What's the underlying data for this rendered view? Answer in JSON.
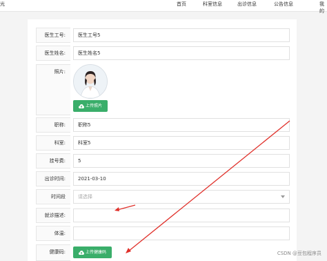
{
  "header": {
    "brand": "光",
    "nav": [
      "首页",
      "科室信息",
      "出诊信息",
      "公告信息",
      "我的"
    ]
  },
  "form": {
    "doctor_id": {
      "label": "医生工号:",
      "value": "医生工号5"
    },
    "doctor_name": {
      "label": "医生姓名:",
      "value": "医生姓名5"
    },
    "photo": {
      "label": "照片:",
      "upload_label": "上传照片"
    },
    "title": {
      "label": "职称:",
      "value": "职称5"
    },
    "department": {
      "label": "科室:",
      "value": "科室5"
    },
    "fee": {
      "label": "挂号费:",
      "value": "5"
    },
    "visit_time": {
      "label": "出诊时间:",
      "value": "2021-03-10"
    },
    "time_slot": {
      "label": "时间段",
      "placeholder": "请选择"
    },
    "consult_desc": {
      "label": "就诊描述:",
      "value": ""
    },
    "temperature": {
      "label": "体温:",
      "value": ""
    },
    "health_code": {
      "label": "健康码:",
      "upload_label": "上传健康码"
    }
  },
  "watermark": "CSDN @豆包程序员",
  "colors": {
    "accent_green": "#3aae6a",
    "annotation_red": "#e0302a"
  }
}
